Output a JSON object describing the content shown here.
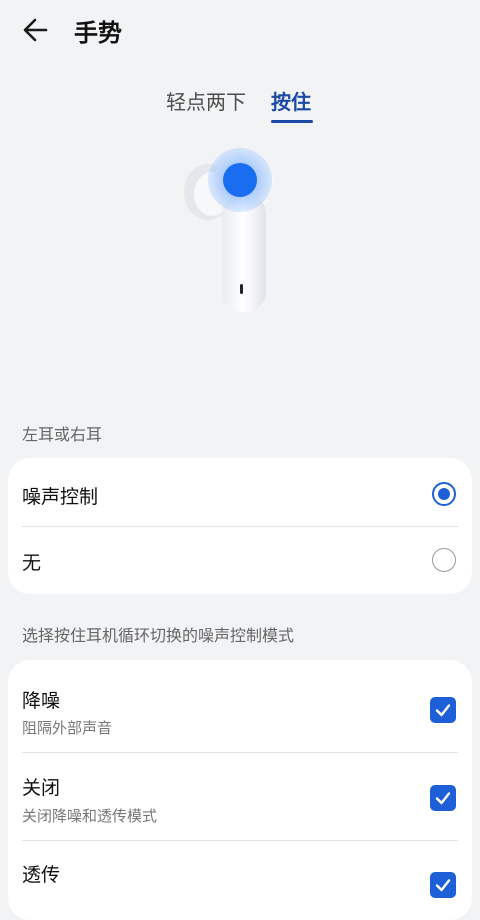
{
  "header": {
    "title": "手势"
  },
  "tabs": [
    {
      "label": "轻点两下",
      "selected": false
    },
    {
      "label": "按住",
      "selected": true
    }
  ],
  "section1": {
    "label": "左耳或右耳",
    "options": [
      {
        "label": "噪声控制",
        "selected": true
      },
      {
        "label": "无",
        "selected": false
      }
    ]
  },
  "section2": {
    "label": "选择按住耳机循环切换的噪声控制模式",
    "items": [
      {
        "title": "降噪",
        "subtitle": "阻隔外部声音",
        "checked": true
      },
      {
        "title": "关闭",
        "subtitle": "关闭降噪和透传模式",
        "checked": true
      },
      {
        "title": "透传",
        "subtitle": "",
        "checked": true
      }
    ]
  },
  "colors": {
    "accent": "#1d5fd6",
    "tab_active": "#1b4aa6",
    "background": "#f1f3f5"
  }
}
